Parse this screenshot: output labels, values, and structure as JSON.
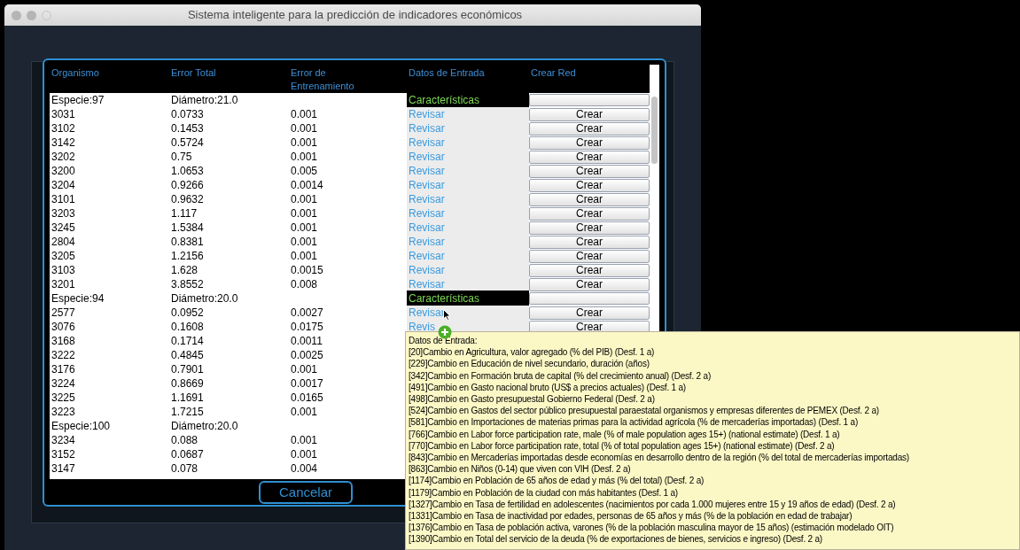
{
  "window": {
    "title": "Sistema inteligente para la predicción de indicadores económicos"
  },
  "table": {
    "columns": [
      "Organismo",
      "Error Total",
      "Error de Entrenamiento",
      "Datos de Entrada",
      "Crear Red"
    ],
    "rows": [
      {
        "kind": "group",
        "species": "Especie:97",
        "diameter": "Diámetro:21.0",
        "features": "Características"
      },
      {
        "kind": "organism",
        "id": "3031",
        "error_total": "0.0733",
        "error_training": "0.001",
        "action": "Revisar",
        "button": "Crear"
      },
      {
        "kind": "organism",
        "id": "3102",
        "error_total": "0.1453",
        "error_training": "0.001",
        "action": "Revisar",
        "button": "Crear"
      },
      {
        "kind": "organism",
        "id": "3142",
        "error_total": "0.5724",
        "error_training": "0.001",
        "action": "Revisar",
        "button": "Crear"
      },
      {
        "kind": "organism",
        "id": "3202",
        "error_total": "0.75",
        "error_training": "0.001",
        "action": "Revisar",
        "button": "Crear"
      },
      {
        "kind": "organism",
        "id": "3200",
        "error_total": "1.0653",
        "error_training": "0.005",
        "action": "Revisar",
        "button": "Crear"
      },
      {
        "kind": "organism",
        "id": "3204",
        "error_total": "0.9266",
        "error_training": "0.0014",
        "action": "Revisar",
        "button": "Crear"
      },
      {
        "kind": "organism",
        "id": "3101",
        "error_total": "0.9632",
        "error_training": "0.001",
        "action": "Revisar",
        "button": "Crear"
      },
      {
        "kind": "organism",
        "id": "3203",
        "error_total": "1.117",
        "error_training": "0.001",
        "action": "Revisar",
        "button": "Crear"
      },
      {
        "kind": "organism",
        "id": "3245",
        "error_total": "1.5384",
        "error_training": "0.001",
        "action": "Revisar",
        "button": "Crear"
      },
      {
        "kind": "organism",
        "id": "2804",
        "error_total": "0.8381",
        "error_training": "0.001",
        "action": "Revisar",
        "button": "Crear"
      },
      {
        "kind": "organism",
        "id": "3205",
        "error_total": "1.2156",
        "error_training": "0.001",
        "action": "Revisar",
        "button": "Crear"
      },
      {
        "kind": "organism",
        "id": "3103",
        "error_total": "1.628",
        "error_training": "0.0015",
        "action": "Revisar",
        "button": "Crear"
      },
      {
        "kind": "organism",
        "id": "3201",
        "error_total": "3.8552",
        "error_training": "0.008",
        "action": "Revisar",
        "button": "Crear"
      },
      {
        "kind": "group",
        "species": "Especie:94",
        "diameter": "Diámetro:20.0",
        "features": "Características"
      },
      {
        "kind": "organism",
        "id": "2577",
        "error_total": "0.0952",
        "error_training": "0.0027",
        "action": "Revisar",
        "button": "Crear"
      },
      {
        "kind": "organism",
        "id": "3076",
        "error_total": "0.1608",
        "error_training": "0.0175",
        "action": "Revis",
        "button": "Crear"
      },
      {
        "kind": "organism",
        "id": "3168",
        "error_total": "0.1714",
        "error_training": "0.0011"
      },
      {
        "kind": "organism",
        "id": "3222",
        "error_total": "0.4845",
        "error_training": "0.0025"
      },
      {
        "kind": "organism",
        "id": "3176",
        "error_total": "0.7901",
        "error_training": "0.001"
      },
      {
        "kind": "organism",
        "id": "3224",
        "error_total": "0.8669",
        "error_training": "0.0017"
      },
      {
        "kind": "organism",
        "id": "3225",
        "error_total": "1.1691",
        "error_training": "0.0165"
      },
      {
        "kind": "organism",
        "id": "3223",
        "error_total": "1.7215",
        "error_training": "0.001"
      },
      {
        "kind": "group",
        "species": "Especie:100",
        "diameter": "Diámetro:20.0"
      },
      {
        "kind": "organism",
        "id": "3234",
        "error_total": "0.088",
        "error_training": "0.001"
      },
      {
        "kind": "organism",
        "id": "3152",
        "error_total": "0.0687",
        "error_training": "0.001"
      },
      {
        "kind": "organism",
        "id": "3147",
        "error_total": "0.078",
        "error_training": "0.004"
      }
    ]
  },
  "cancel_button": "Cancelar",
  "tooltip": {
    "title": "Datos de Entrada:",
    "lines": [
      "[20]Cambio en Agricultura, valor agregado (% del PIB) (Desf. 1 a)",
      "[229]Cambio en Educación de nivel secundario, duración (años)",
      "[342]Cambio en Formación bruta de capital (% del crecimiento anual) (Desf. 2 a)",
      "[491]Cambio en Gasto nacional bruto (US$ a precios actuales) (Desf. 1 a)",
      "[498]Cambio en Gasto presupuestal Gobierno Federal (Desf. 2 a)",
      "[524]Cambio en Gastos del sector público presupuestal paraestatal organismos y empresas diferentes de PEMEX (Desf. 2 a)",
      "[581]Cambio en Importaciones de materias primas para la actividad agrícola (% de mercaderías importadas) (Desf. 1 a)",
      "[766]Cambio en Labor force participation rate, male (% of male population ages 15+) (national estimate) (Desf. 1 a)",
      "[770]Cambio en Labor force participation rate, total (% of total population ages 15+) (national estimate) (Desf. 2 a)",
      "[843]Cambio en Mercaderías importadas desde economías en desarrollo dentro de la región (% del total de mercaderías importadas)",
      "[863]Cambio en Niños (0-14) que viven con VIH (Desf. 2 a)",
      "[1174]Cambio en Población de 65 años de edad y más (% del total) (Desf. 2 a)",
      "[1179]Cambio en Población de la ciudad con más habitantes (Desf. 1 a)",
      "[1327]Cambio en Tasa de fertilidad en adolescentes (nacimientos por cada 1.000 mujeres entre 15 y 19 años de edad) (Desf. 2 a)",
      "[1331]Cambio en Tasa de inactividad por edades, personas de 65 años y más (% de la población en edad de trabajar)",
      "[1376]Cambio en Tasa de población activa, varones (% de la población masculina mayor de 15 años) (estimación modelado OIT)",
      "[1390]Cambio en Total del servicio de la deuda (% de exportaciones de bienes, servicios e ingreso) (Desf. 2 a)"
    ]
  }
}
